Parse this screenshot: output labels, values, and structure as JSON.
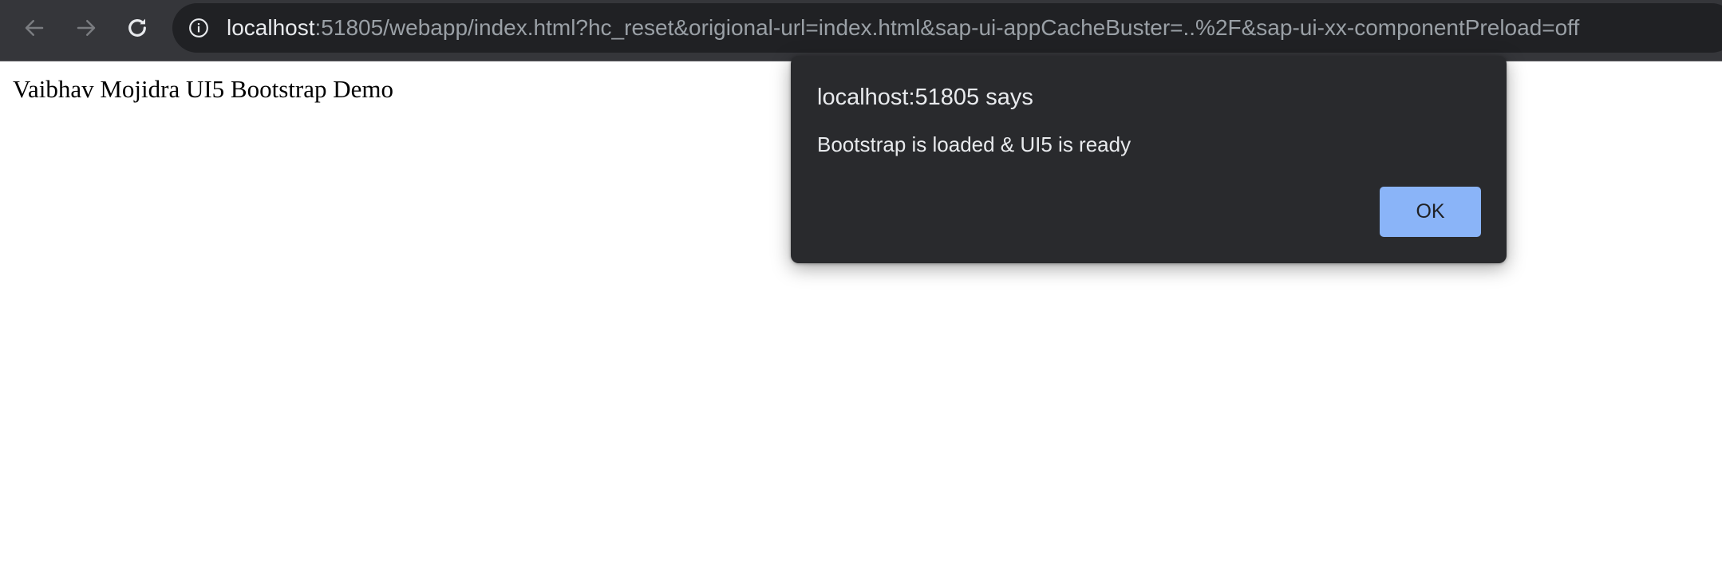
{
  "browser": {
    "url_host": "localhost",
    "url_rest": ":51805/webapp/index.html?hc_reset&origional-url=index.html&sap-ui-appCacheBuster=..%2F&sap-ui-xx-componentPreload=off",
    "icons": {
      "back": "arrow-left-icon",
      "forward": "arrow-right-icon",
      "reload": "reload-icon",
      "site_info": "info-icon"
    }
  },
  "page": {
    "title": "Vaibhav Mojidra UI5 Bootstrap Demo"
  },
  "alert_dialog": {
    "title": "localhost:51805 says",
    "message": "Bootstrap is loaded & UI5 is ready",
    "ok_label": "OK"
  },
  "colors": {
    "toolbar_bg": "#35363a",
    "omnibox_bg": "#202124",
    "dialog_bg": "#292a2d",
    "button_accent": "#8ab4f8"
  }
}
